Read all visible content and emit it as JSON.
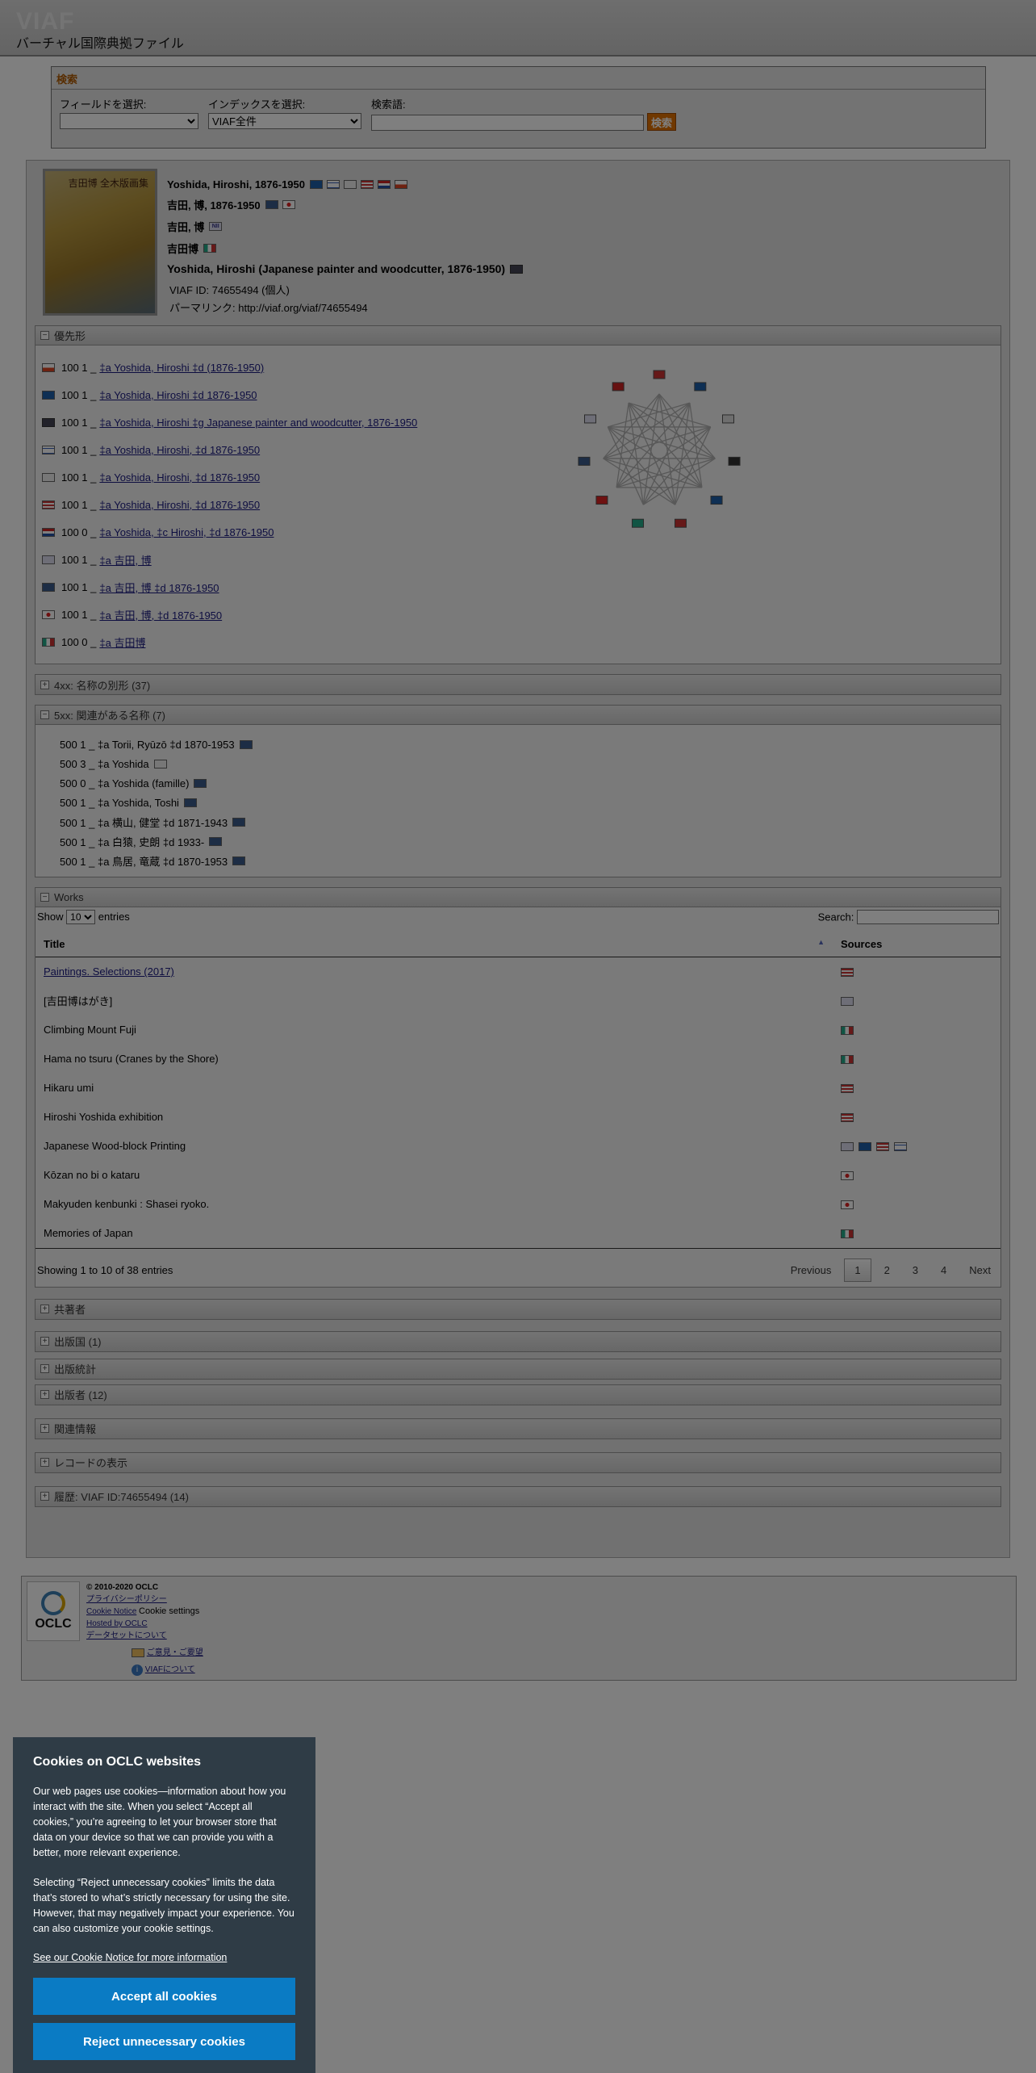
{
  "header": {
    "logo": "VIAF",
    "subtitle": "バーチャル国際典拠ファイル"
  },
  "search": {
    "title": "検索",
    "field_label": "フィールドを選択:",
    "field_value": "",
    "index_label": "インデックスを選択:",
    "index_value": "VIAF全件",
    "term_label": "検索語:",
    "term_value": "",
    "button": "検索"
  },
  "record": {
    "cover_title": "吉田博 全木版画集",
    "headings": [
      {
        "text": "Yoshida, Hiroshi, 1876-1950",
        "flags": [
          "dnb",
          "is",
          "sudoc",
          "us",
          "nl",
          "pl"
        ]
      },
      {
        "text": "吉田, 博, 1876-1950",
        "flags": [
          "wk",
          "jp"
        ]
      },
      {
        "text": "吉田, 博",
        "flags": [
          "ni"
        ]
      },
      {
        "text": "吉田博",
        "flags": [
          "it"
        ]
      },
      {
        "text": "Yoshida, Hiroshi (Japanese painter and woodcutter, 1876-1950)",
        "flags": [
          "bnf"
        ]
      }
    ],
    "viaf_id": "VIAF ID: 74655494 (個人)",
    "permalink": "パーマリンク: http://viaf.org/viaf/74655494"
  },
  "preferred": {
    "title": "優先形",
    "rows": [
      {
        "flag": "pl",
        "tag": "100 1 _",
        "link": "‡a  Yoshida, Hiroshi ‡d  (1876-1950)"
      },
      {
        "flag": "dnb",
        "tag": "100 1 _",
        "link": "‡a  Yoshida, Hiroshi ‡d  1876-1950"
      },
      {
        "flag": "bnf",
        "tag": "100 1 _",
        "link": "‡a  Yoshida, Hiroshi ‡g  Japanese painter and woodcutter, 1876-1950"
      },
      {
        "flag": "is",
        "tag": "100 1 _",
        "link": "‡a  Yoshida, Hiroshi,  ‡d  1876-1950"
      },
      {
        "flag": "sudoc",
        "tag": "100 1 _",
        "link": "‡a  Yoshida, Hiroshi,  ‡d  1876-1950"
      },
      {
        "flag": "us",
        "tag": "100 1 _",
        "link": "‡a  Yoshida, Hiroshi,  ‡d  1876-1950"
      },
      {
        "flag": "nl",
        "tag": "100 0 _",
        "link": "‡a  Yoshida,  ‡c  Hiroshi,  ‡d  1876-1950"
      },
      {
        "flag": "ni",
        "tag": "100 1 _",
        "link": "‡a  吉田, 博"
      },
      {
        "flag": "wk",
        "tag": "100 1 _",
        "link": "‡a  吉田, 博  ‡d  1876-1950"
      },
      {
        "flag": "jp",
        "tag": "100 1 _",
        "link": "‡a  吉田, 博,  ‡d  1876-1950"
      },
      {
        "flag": "it",
        "tag": "100 0 _",
        "link": "‡a  吉田博"
      }
    ]
  },
  "alt_forms": {
    "title": "4xx: 名称の別形 (37)"
  },
  "related": {
    "title": "5xx: 関連がある名称 (7)",
    "rows": [
      {
        "text": "500 1 _ ‡a  Torii, Ryūzō ‡d  1870-1953",
        "flag": "wk"
      },
      {
        "text": "500 3 _ ‡a  Yoshida",
        "flag": "sudoc"
      },
      {
        "text": "500 0 _ ‡a  Yoshida (famille)",
        "flag": "wk"
      },
      {
        "text": "500 1 _ ‡a  Yoshida, Toshi",
        "flag": "wk"
      },
      {
        "text": "500 1 _ ‡a  横山, 健堂 ‡d  1871-1943",
        "flag": "wk"
      },
      {
        "text": "500 1 _ ‡a  白猿, 史朗 ‡d  1933-",
        "flag": "wk"
      },
      {
        "text": "500 1 _ ‡a  鳥居, 竜蔵 ‡d  1870-1953",
        "flag": "wk"
      }
    ]
  },
  "works": {
    "title": "Works",
    "show": "Show",
    "entries_value": "10",
    "entries": "entries",
    "search_label": "Search:",
    "col_title": "Title",
    "col_sources": "Sources",
    "rows": [
      {
        "title": "Paintings. Selections (2017)",
        "link": true,
        "flags": [
          "us"
        ]
      },
      {
        "title": "[吉田博はがき]",
        "link": false,
        "flags": [
          "ni"
        ]
      },
      {
        "title": "Climbing Mount Fuji",
        "link": false,
        "flags": [
          "it"
        ]
      },
      {
        "title": "Hama no tsuru (Cranes by the Shore)",
        "link": false,
        "flags": [
          "it"
        ]
      },
      {
        "title": "Hikaru umi",
        "link": false,
        "flags": [
          "us"
        ]
      },
      {
        "title": "Hiroshi Yoshida exhibition",
        "link": false,
        "flags": [
          "us"
        ]
      },
      {
        "title": "Japanese Wood-block Printing",
        "link": false,
        "flags": [
          "ni",
          "dnb",
          "us",
          "is"
        ]
      },
      {
        "title": "Kōzan no bi o kataru",
        "link": false,
        "flags": [
          "jp"
        ]
      },
      {
        "title": "Makyuden kenbunki : Shasei ryoko.",
        "link": false,
        "flags": [
          "jp"
        ]
      },
      {
        "title": "Memories of Japan",
        "link": false,
        "flags": [
          "it"
        ]
      }
    ],
    "info": "Showing 1 to 10 of 38 entries",
    "prev": "Previous",
    "pages": [
      "1",
      "2",
      "3",
      "4"
    ],
    "next": "Next"
  },
  "collapsed": [
    "共著者",
    "出版国 (1)",
    "出版統計",
    "出版者 (12)",
    "関連情報",
    "レコードの表示",
    "履歴: VIAF ID:74655494 (14)"
  ],
  "footer": {
    "logo_text": "OCLC",
    "copyright": "© 2010-2020 OCLC",
    "privacy": "プライバシーポリシー",
    "cookie_notice": "Cookie Notice",
    "cookie_settings": "Cookie settings",
    "hosted": "Hosted by OCLC",
    "dataset": "データセットについて",
    "feedback": "ご意見・ご要望",
    "about": "VIAFについて"
  },
  "cookie": {
    "title": "Cookies on OCLC websites",
    "p1": "Our web pages use cookies—information about how you interact with the site. When you select “Accept all cookies,” you’re agreeing to let your browser store that data on your device so that we can provide you with a better, more relevant experience.",
    "p2": "Selecting “Reject unnecessary cookies” limits the data that’s stored to what’s strictly necessary for using the site. However, that may negatively impact your experience. You can also customize your cookie settings.",
    "link": "See our Cookie Notice for more information",
    "accept": "Accept all cookies",
    "reject": "Reject unnecessary cookies"
  }
}
